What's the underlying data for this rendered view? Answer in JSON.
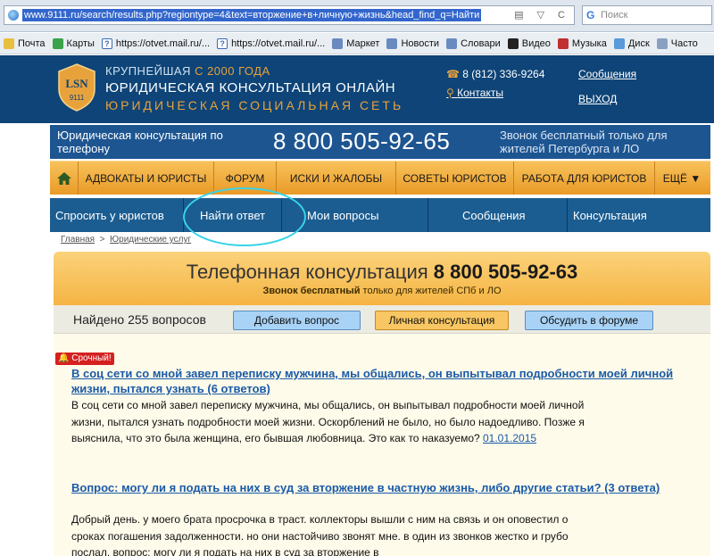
{
  "browser": {
    "url": "www.9111.ru/search/results.php?regiontype=4&text=вторжение+в+личную+жизнь&head_find_q=Найти",
    "search_placeholder": "Поиск",
    "bookmarks": [
      "Почта",
      "Карты",
      "https://otvet.mail.ru/...",
      "https://otvet.mail.ru/...",
      "Маркет",
      "Новости",
      "Словари",
      "Видео",
      "Музыка",
      "Диск",
      "Часто"
    ]
  },
  "header": {
    "logo_text": "LSN",
    "logo_sub": "9111",
    "brand_line1": "КРУПНЕЙШАЯ",
    "brand_line1_accent": "С 2000 ГОДА",
    "brand_line2": "ЮРИДИЧЕСКАЯ КОНСУЛЬТАЦИЯ ОНЛАЙН",
    "brand_line3": "ЮРИДИЧЕСКАЯ СОЦИАЛЬНАЯ СЕТЬ",
    "phone": "8 (812) 336-9264",
    "contacts": "Контакты",
    "messages": "Сообщения",
    "exit": "ВЫХОД"
  },
  "phone_banner": {
    "left": "Юридическая консультация по телефону",
    "number": "8 800 505-92-65",
    "right": "Звонок бесплатный только для жителей Петербурга и ЛО"
  },
  "nav": {
    "items": [
      "АДВОКАТЫ И ЮРИСТЫ",
      "ФОРУМ",
      "ИСКИ И ЖАЛОБЫ",
      "СОВЕТЫ ЮРИСТОВ",
      "РАБОТА ДЛЯ ЮРИСТОВ",
      "ЕЩЁ ▼"
    ]
  },
  "tabs": [
    "Спросить у юристов",
    "Найти ответ",
    "Мои вопросы",
    "Сообщения",
    "Консультация"
  ],
  "breadcrumb": {
    "home": "Главная",
    "sep": ">",
    "current": "Юридические услуг"
  },
  "banner": {
    "title": "Телефонная консультация",
    "number": "8 800 505-92-63",
    "sub_bold": "Звонок бесплатный",
    "sub_rest": " только для жителей СПб и ЛО"
  },
  "results": {
    "found": "Найдено 255 вопросов",
    "add_button": "Добавить вопрос",
    "consult_button": "Личная консультация",
    "forum_button": "Обсудить в форуме"
  },
  "questions": [
    {
      "badge": "Срочный!",
      "title": "В соц сети со мной завел переписку мужчина, мы общались, он выпытывал подробности моей личной жизни, пытался узнать (6 ответов)",
      "body": "В соц сети со мной завел переписку мужчина, мы общались, он выпытывал подробности моей личной жизни, пытался узнать подробности моей жизни. Оскорблений не было, но было надоедливо. Позже я выяснила, что это была женщина, его бывшая любовница. Это как то наказуемо? ",
      "date": "01.01.2015"
    },
    {
      "title": "Вопрос: могу ли я подать на них в суд за вторжение в частную жизнь, либо другие статьи? (3 ответа)",
      "body": "Добрый день. у моего брата просрочка в траст. коллекторы вышли с ним на связь и он оповестил о сроках погашения задолженности. но они настойчиво звонят мне. в один из звонков жестко и грубо послал. вопрос: могу ли я подать на них в суд за вторжение в"
    }
  ]
}
